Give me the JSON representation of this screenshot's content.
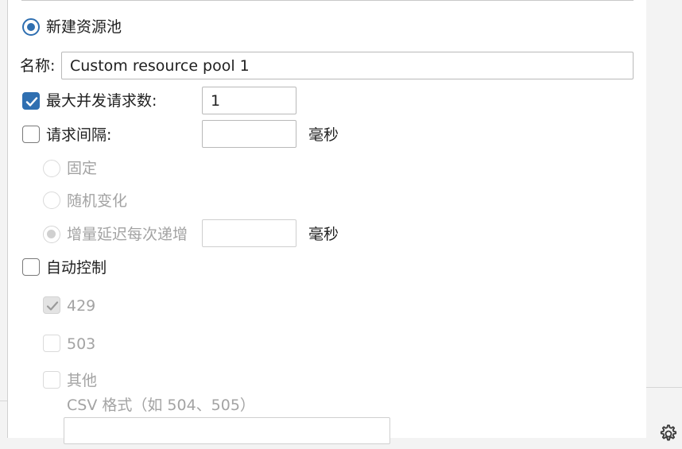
{
  "pool_mode": {
    "new_pool_label": "新建资源池"
  },
  "name": {
    "label": "名称:",
    "value": "Custom resource pool 1"
  },
  "max_concurrent": {
    "label": "最大并发请求数:",
    "value": "1",
    "checked": true
  },
  "interval": {
    "label": "请求间隔:",
    "value": "",
    "unit": "毫秒",
    "checked": false,
    "options": {
      "fixed": "固定",
      "random": "随机变化",
      "increment": "增量延迟每次递增"
    },
    "increment_value": "",
    "increment_unit": "毫秒"
  },
  "auto_control": {
    "label": "自动控制",
    "checked": false,
    "codes": {
      "c429": {
        "label": "429",
        "checked": true
      },
      "c503": {
        "label": "503",
        "checked": false
      },
      "other": {
        "label": "其他",
        "checked": false
      }
    },
    "csv_hint": "CSV 格式（如 504、505）",
    "csv_value": ""
  },
  "icons": {
    "settings": "gear-icon"
  },
  "colors": {
    "accent": "#2f6fb1",
    "disabled_text": "#a3a3a3"
  }
}
